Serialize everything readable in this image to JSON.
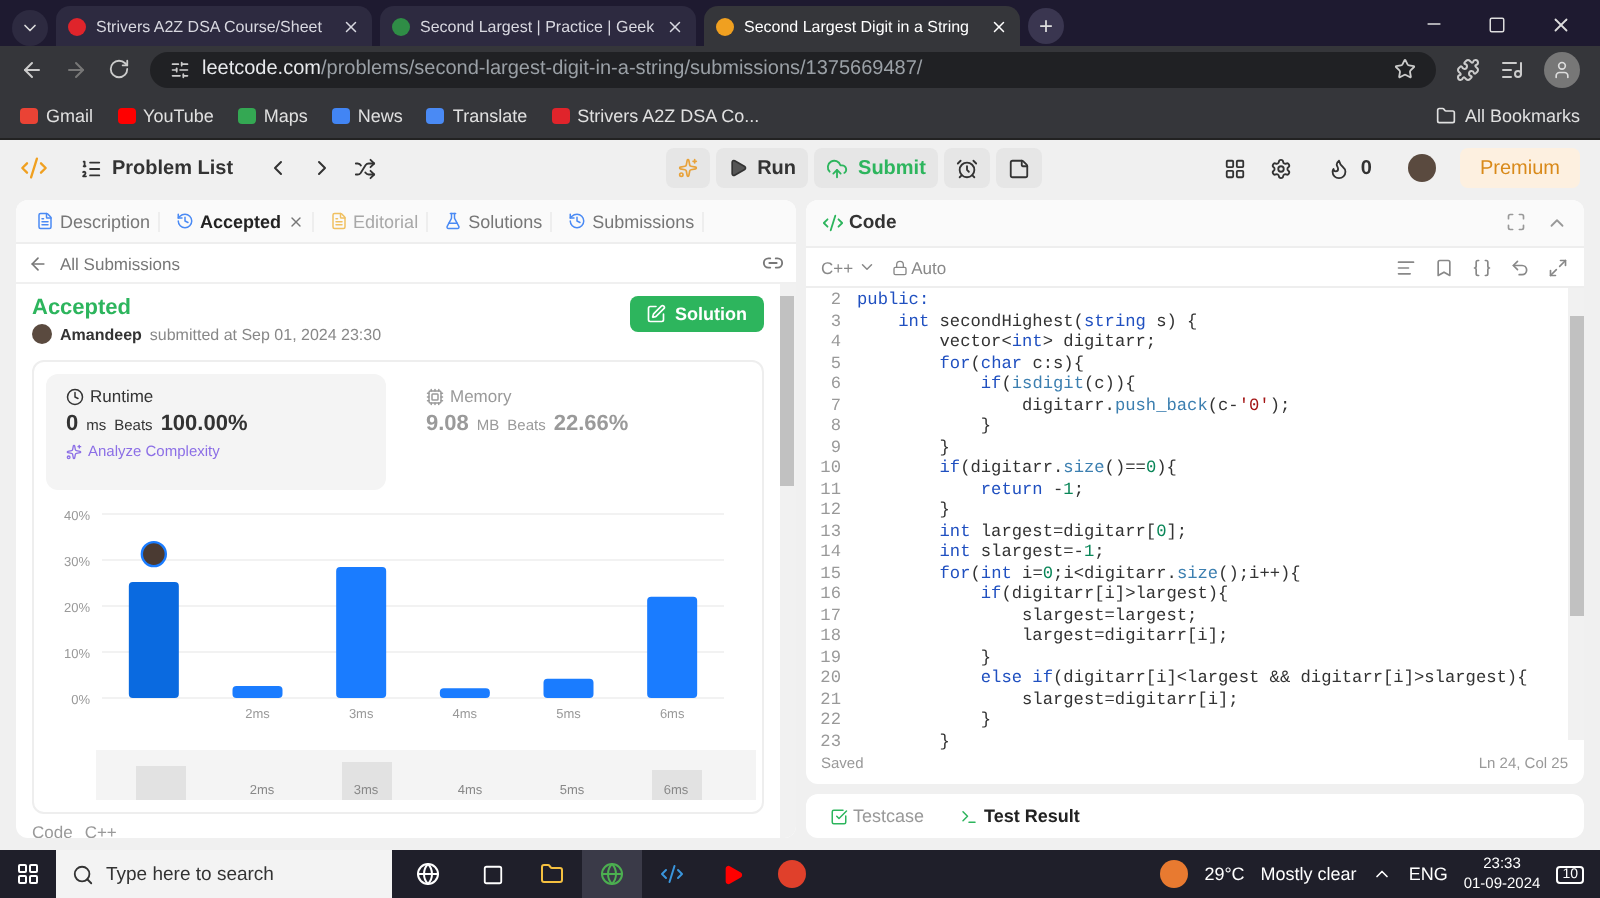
{
  "browser": {
    "tabs": [
      {
        "title": "Strivers A2Z DSA Course/Sheet",
        "selected": false,
        "color": "#e0242b"
      },
      {
        "title": "Second Largest | Practice | Geek",
        "selected": false,
        "color": "#2f8d46"
      },
      {
        "title": "Second Largest Digit in a String",
        "selected": true,
        "color": "#f0a020"
      }
    ],
    "new_tab": "+",
    "address": {
      "domain": "leetcode.com",
      "path": "/problems/second-largest-digit-in-a-string/submissions/1375669487/"
    },
    "bookmarks": [
      {
        "label": "Gmail",
        "color": "#ea4335"
      },
      {
        "label": "YouTube",
        "color": "#ff0000"
      },
      {
        "label": "Maps",
        "color": "#34a853"
      },
      {
        "label": "News",
        "color": "#4285f4"
      },
      {
        "label": "Translate",
        "color": "#4a8af4"
      },
      {
        "label": "Strivers A2Z DSA Co...",
        "color": "#e0242b"
      }
    ],
    "all_bookmarks": "All Bookmarks"
  },
  "nav": {
    "problem_list": "Problem List",
    "run": "Run",
    "submit": "Submit",
    "coins": "0",
    "premium": "Premium"
  },
  "left": {
    "tabs": [
      {
        "label": "Description",
        "selected": false,
        "disabled": false,
        "closable": false
      },
      {
        "label": "Accepted",
        "selected": true,
        "disabled": false,
        "closable": true
      },
      {
        "label": "Editorial",
        "selected": false,
        "disabled": true,
        "closable": false
      },
      {
        "label": "Solutions",
        "selected": false,
        "disabled": false,
        "closable": false
      },
      {
        "label": "Submissions",
        "selected": false,
        "disabled": false,
        "closable": false
      }
    ],
    "back": "All Submissions",
    "status": "Accepted",
    "author": "Amandeep",
    "submitted": "submitted at Sep 01, 2024 23:30",
    "solution_button": "Solution",
    "metrics": [
      {
        "kind": "runtime",
        "title": "Runtime",
        "value": "0",
        "unit": "ms",
        "beats_label": "Beats",
        "beats": "100.00%",
        "selected": true,
        "analyze": "Analyze Complexity"
      },
      {
        "kind": "memory",
        "title": "Memory",
        "value": "9.08",
        "unit": "MB",
        "beats_label": "Beats",
        "beats": "22.66%",
        "selected": false
      }
    ],
    "chart_data": {
      "type": "bar",
      "x": [
        1,
        2,
        3,
        4,
        5,
        6
      ],
      "values": [
        25.2,
        2.6,
        28.5,
        2.1,
        4.2,
        22
      ],
      "xlim": [
        0.5,
        6.5
      ],
      "ylim": [
        0,
        40
      ],
      "grid": true,
      "yticks": [
        {
          "value": 0,
          "label": "0%"
        },
        {
          "value": 10,
          "label": "10%"
        },
        {
          "value": 20,
          "label": "20%"
        },
        {
          "value": 30,
          "label": "30%"
        },
        {
          "value": 40,
          "label": "40%"
        }
      ],
      "xticks": [
        {
          "value": 2,
          "label": "2ms"
        },
        {
          "value": 3,
          "label": "3ms"
        },
        {
          "value": 4,
          "label": "4ms"
        },
        {
          "value": 5,
          "label": "5ms"
        },
        {
          "value": 6,
          "label": "6ms"
        }
      ]
    },
    "navigator_labels": [
      "2ms",
      "3ms",
      "4ms",
      "5ms",
      "6ms"
    ],
    "footer": [
      "Code",
      "C++"
    ]
  },
  "code": {
    "title": "Code",
    "language": "C++",
    "mode": "Auto",
    "lines": [
      {
        "n": "2",
        "tokens": [
          {
            "t": "public:",
            "kind": "keyword"
          }
        ]
      },
      {
        "n": "3",
        "tokens": [
          {
            "t": "    int",
            "kind": "keyword"
          },
          {
            "t": " secondHighest(",
            "kind": "plain"
          },
          {
            "t": "string",
            "kind": "keyword"
          },
          {
            "t": " s) {",
            "kind": "plain"
          }
        ]
      },
      {
        "n": "4",
        "tokens": [
          {
            "t": "        vector<",
            "kind": "plain"
          },
          {
            "t": "int",
            "kind": "keyword"
          },
          {
            "t": "> digitarr;",
            "kind": "plain"
          }
        ]
      },
      {
        "n": "5",
        "tokens": [
          {
            "t": "        for",
            "kind": "keyword"
          },
          {
            "t": "(",
            "kind": "plain"
          },
          {
            "t": "char",
            "kind": "keyword"
          },
          {
            "t": " c:s){",
            "kind": "plain"
          }
        ]
      },
      {
        "n": "6",
        "tokens": [
          {
            "t": "            if",
            "kind": "keyword"
          },
          {
            "t": "(",
            "kind": "plain"
          },
          {
            "t": "isdigit",
            "kind": "function"
          },
          {
            "t": "(c)){",
            "kind": "plain"
          }
        ]
      },
      {
        "n": "7",
        "tokens": [
          {
            "t": "                digitarr.",
            "kind": "plain"
          },
          {
            "t": "push_back",
            "kind": "function"
          },
          {
            "t": "(c-",
            "kind": "plain"
          },
          {
            "t": "'0'",
            "kind": "string"
          },
          {
            "t": ");",
            "kind": "plain"
          }
        ]
      },
      {
        "n": "8",
        "tokens": [
          {
            "t": "            }",
            "kind": "plain"
          }
        ]
      },
      {
        "n": "9",
        "tokens": [
          {
            "t": "        }",
            "kind": "plain"
          }
        ]
      },
      {
        "n": "10",
        "tokens": [
          {
            "t": "        if",
            "kind": "keyword"
          },
          {
            "t": "(digitarr.",
            "kind": "plain"
          },
          {
            "t": "size",
            "kind": "function"
          },
          {
            "t": "()==",
            "kind": "plain"
          },
          {
            "t": "0",
            "kind": "number"
          },
          {
            "t": "){",
            "kind": "plain"
          }
        ]
      },
      {
        "n": "11",
        "tokens": [
          {
            "t": "            return",
            "kind": "keyword"
          },
          {
            "t": " -",
            "kind": "plain"
          },
          {
            "t": "1",
            "kind": "number"
          },
          {
            "t": ";",
            "kind": "plain"
          }
        ]
      },
      {
        "n": "12",
        "tokens": [
          {
            "t": "        }",
            "kind": "plain"
          }
        ]
      },
      {
        "n": "13",
        "tokens": [
          {
            "t": "        int",
            "kind": "keyword"
          },
          {
            "t": " largest=digitarr[",
            "kind": "plain"
          },
          {
            "t": "0",
            "kind": "number"
          },
          {
            "t": "];",
            "kind": "plain"
          }
        ]
      },
      {
        "n": "14",
        "tokens": [
          {
            "t": "        int",
            "kind": "keyword"
          },
          {
            "t": " slargest=-",
            "kind": "plain"
          },
          {
            "t": "1",
            "kind": "number"
          },
          {
            "t": ";",
            "kind": "plain"
          }
        ]
      },
      {
        "n": "15",
        "tokens": [
          {
            "t": "        for",
            "kind": "keyword"
          },
          {
            "t": "(",
            "kind": "plain"
          },
          {
            "t": "int",
            "kind": "keyword"
          },
          {
            "t": " i=",
            "kind": "plain"
          },
          {
            "t": "0",
            "kind": "number"
          },
          {
            "t": ";i<digitarr.",
            "kind": "plain"
          },
          {
            "t": "size",
            "kind": "function"
          },
          {
            "t": "();i++){",
            "kind": "plain"
          }
        ]
      },
      {
        "n": "16",
        "tokens": [
          {
            "t": "            if",
            "kind": "keyword"
          },
          {
            "t": "(digitarr[i]>largest){",
            "kind": "plain"
          }
        ]
      },
      {
        "n": "17",
        "tokens": [
          {
            "t": "                slargest=largest;",
            "kind": "plain"
          }
        ]
      },
      {
        "n": "18",
        "tokens": [
          {
            "t": "                largest=digitarr[i];",
            "kind": "plain"
          }
        ]
      },
      {
        "n": "19",
        "tokens": [
          {
            "t": "            }",
            "kind": "plain"
          }
        ]
      },
      {
        "n": "20",
        "tokens": [
          {
            "t": "            else if",
            "kind": "keyword"
          },
          {
            "t": "(digitarr[i]<largest && digitarr[i]>slargest){",
            "kind": "plain"
          }
        ]
      },
      {
        "n": "21",
        "tokens": [
          {
            "t": "                slargest=digitarr[i];",
            "kind": "plain"
          }
        ]
      },
      {
        "n": "22",
        "tokens": [
          {
            "t": "            }",
            "kind": "plain"
          }
        ]
      },
      {
        "n": "23",
        "tokens": [
          {
            "t": "        }",
            "kind": "plain"
          }
        ]
      }
    ],
    "status": "Saved",
    "position": "Ln 24, Col 25"
  },
  "bottom_tabs": [
    {
      "label": "Testcase",
      "selected": false
    },
    {
      "label": "Test Result",
      "selected": true
    }
  ],
  "taskbar": {
    "search_placeholder": "Type here to search",
    "temperature": "29°C",
    "weather": "Mostly clear",
    "language": "ENG",
    "time": "23:33",
    "date": "01-09-2024",
    "notifications": "10"
  }
}
